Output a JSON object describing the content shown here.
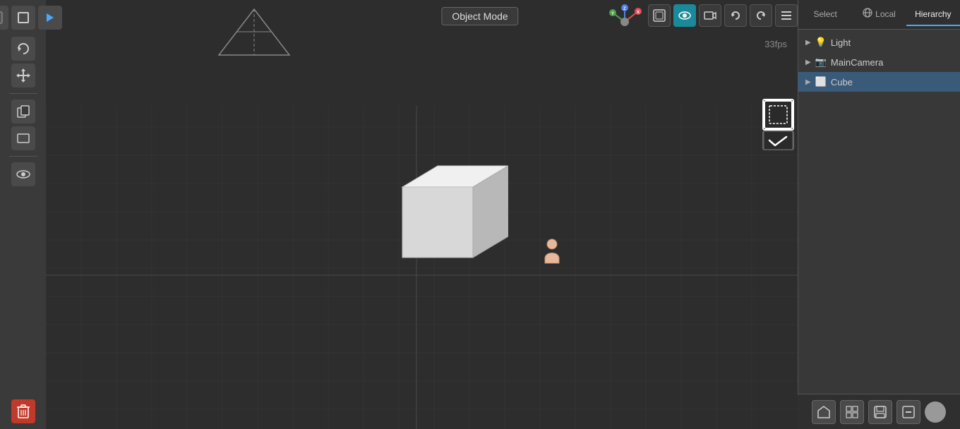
{
  "viewport": {
    "background": "#2d2d2d",
    "fps": "33fps",
    "mode": "Object Mode"
  },
  "left_toolbar": {
    "buttons": [
      {
        "id": "blender-logo",
        "icon": "⬛",
        "label": "blender-logo",
        "active": false
      },
      {
        "id": "box-select",
        "icon": "▣",
        "label": "box-icon",
        "active": false
      },
      {
        "id": "play",
        "icon": "▶",
        "label": "play-icon",
        "active": false
      },
      {
        "id": "rotate",
        "icon": "↺",
        "label": "rotate-icon",
        "active": false
      },
      {
        "id": "move",
        "icon": "✛",
        "label": "move-icon",
        "active": false
      },
      {
        "id": "copy",
        "icon": "❐",
        "label": "copy-icon",
        "active": false
      },
      {
        "id": "frame",
        "icon": "▭",
        "label": "frame-icon",
        "active": false
      },
      {
        "id": "view",
        "icon": "👁",
        "label": "view-icon",
        "active": false
      },
      {
        "id": "delete",
        "icon": "🗑",
        "label": "delete-icon",
        "active": false,
        "red": true
      }
    ]
  },
  "top_right_icons": [
    {
      "id": "gizmo-icon",
      "icon": "⊕",
      "label": "gizmo-button"
    },
    {
      "id": "perspective-icon",
      "icon": "⬡",
      "label": "perspective-button"
    },
    {
      "id": "render-icon",
      "icon": "👁",
      "label": "render-preview-button",
      "active": true
    },
    {
      "id": "camera-icon",
      "icon": "📷",
      "label": "camera-button"
    },
    {
      "id": "undo-icon",
      "icon": "↩",
      "label": "undo-button"
    },
    {
      "id": "redo-icon",
      "icon": "↪",
      "label": "redo-button"
    },
    {
      "id": "menu-icon",
      "icon": "☰",
      "label": "menu-button"
    }
  ],
  "header_bar": {
    "select_label": "Select",
    "local_label": "Local",
    "hierarchy_label": "Hierarchy",
    "globe_icon": "🌐"
  },
  "hierarchy": {
    "items": [
      {
        "id": "light",
        "label": "Light",
        "icon": "▶",
        "type": "light"
      },
      {
        "id": "main-camera",
        "label": "MainCamera",
        "icon": "▶",
        "type": "camera"
      },
      {
        "id": "cube",
        "label": "Cube",
        "icon": "▶",
        "type": "mesh",
        "selected": true
      }
    ]
  },
  "bottom_panel_buttons": [
    {
      "id": "scene-btn",
      "icon": "▣",
      "label": "scene-button"
    },
    {
      "id": "grid-btn",
      "icon": "⊞",
      "label": "grid-button"
    },
    {
      "id": "save-btn",
      "icon": "💾",
      "label": "save-button"
    },
    {
      "id": "settings-btn",
      "icon": "⊟",
      "label": "settings-button"
    },
    {
      "id": "circle-btn",
      "icon": "",
      "label": "circle-button",
      "circle": true
    }
  ]
}
